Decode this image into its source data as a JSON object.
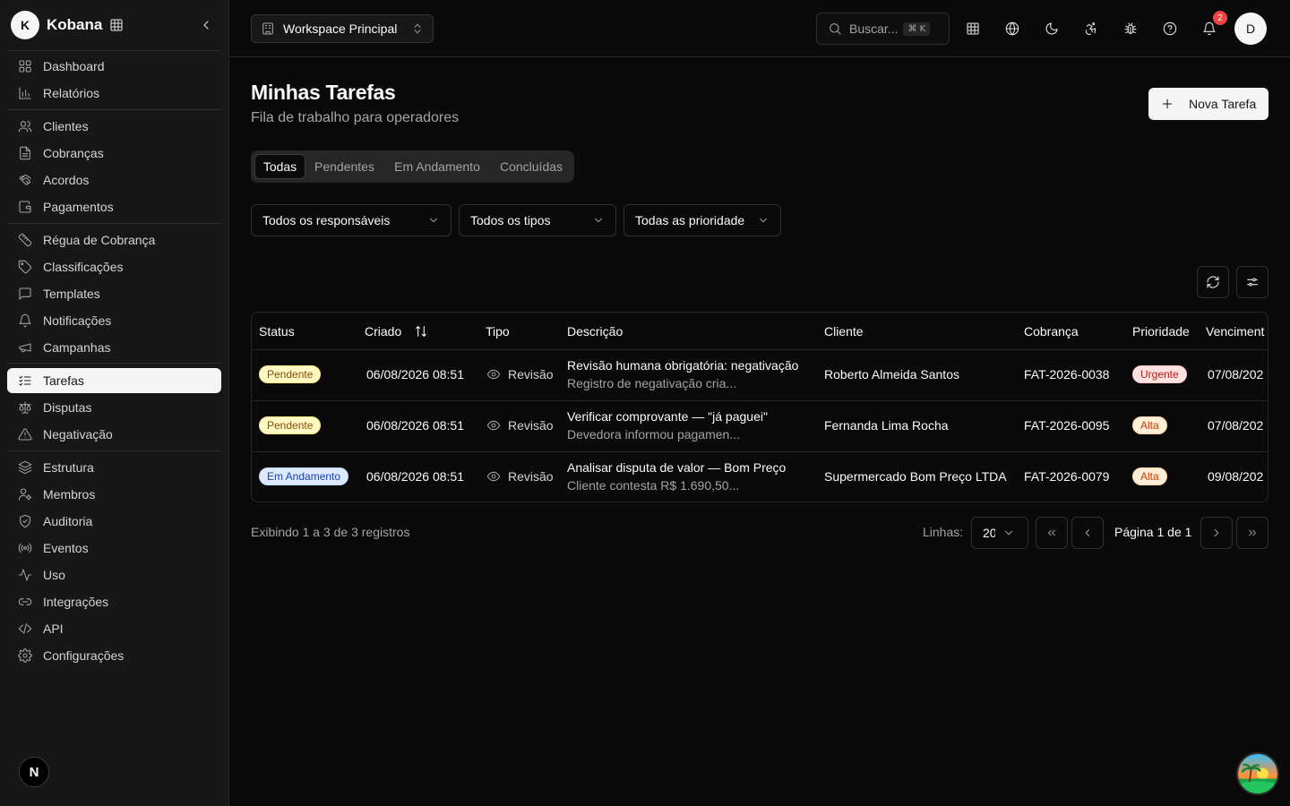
{
  "brand": {
    "avatar_letter": "K",
    "name": "Kobana"
  },
  "sidebar": {
    "groups": [
      [
        {
          "label": "Dashboard",
          "icon": "layout-grid-icon"
        },
        {
          "label": "Relatórios",
          "icon": "bar-chart-icon"
        }
      ],
      [
        {
          "label": "Clientes",
          "icon": "users-icon"
        },
        {
          "label": "Cobranças",
          "icon": "file-text-icon"
        },
        {
          "label": "Acordos",
          "icon": "handshake-icon"
        },
        {
          "label": "Pagamentos",
          "icon": "wallet-icon"
        }
      ],
      [
        {
          "label": "Régua de Cobrança",
          "icon": "ruler-icon"
        },
        {
          "label": "Classificações",
          "icon": "tag-icon"
        },
        {
          "label": "Templates",
          "icon": "message-square-icon"
        },
        {
          "label": "Notificações",
          "icon": "bell-icon"
        },
        {
          "label": "Campanhas",
          "icon": "megaphone-icon"
        }
      ],
      [
        {
          "label": "Tarefas",
          "icon": "list-checks-icon",
          "active": true
        },
        {
          "label": "Disputas",
          "icon": "scale-icon"
        },
        {
          "label": "Negativação",
          "icon": "alert-triangle-icon"
        }
      ],
      [
        {
          "label": "Estrutura",
          "icon": "layers-icon"
        },
        {
          "label": "Membros",
          "icon": "user-cog-icon"
        },
        {
          "label": "Auditoria",
          "icon": "shield-check-icon"
        },
        {
          "label": "Eventos",
          "icon": "radio-icon"
        },
        {
          "label": "Uso",
          "icon": "activity-icon"
        },
        {
          "label": "Integrações",
          "icon": "link-icon"
        },
        {
          "label": "API",
          "icon": "code-icon"
        },
        {
          "label": "Configurações",
          "icon": "settings-icon"
        }
      ]
    ],
    "footer_badge": "N"
  },
  "topbar": {
    "workspace": "Workspace Principal",
    "search_placeholder": "Buscar...",
    "search_shortcut": "⌘ K",
    "notification_count": "2",
    "user_initial": "D"
  },
  "page": {
    "title": "Minhas Tarefas",
    "subtitle": "Fila de trabalho para operadores",
    "new_button": "Nova Tarefa"
  },
  "tabs": [
    {
      "label": "Todas",
      "active": true
    },
    {
      "label": "Pendentes"
    },
    {
      "label": "Em Andamento"
    },
    {
      "label": "Concluídas"
    }
  ],
  "filters": {
    "responsible": "Todos os responsáveis",
    "type": "Todos os tipos",
    "priority": "Todas as prioridade"
  },
  "table": {
    "columns": [
      "Status",
      "Criado",
      "Tipo",
      "Descrição",
      "Cliente",
      "Cobrança",
      "Prioridade",
      "Venciment"
    ],
    "rows": [
      {
        "status": "Pendente",
        "status_kind": "pend",
        "created": "06/08/2026 08:51",
        "type": "Revisão",
        "desc_title": "Revisão humana obrigatória: negativação",
        "desc_sub": "Registro de negativação cria...",
        "client": "Roberto Almeida Santos",
        "charge": "FAT-2026-0038",
        "priority": "Urgente",
        "priority_kind": "urg",
        "due": "07/08/202"
      },
      {
        "status": "Pendente",
        "status_kind": "pend",
        "created": "06/08/2026 08:51",
        "type": "Revisão",
        "desc_title": "Verificar comprovante — \"já paguei\"",
        "desc_sub": "Devedora informou pagamen...",
        "client": "Fernanda Lima Rocha",
        "charge": "FAT-2026-0095",
        "priority": "Alta",
        "priority_kind": "alta",
        "due": "07/08/202"
      },
      {
        "status": "Em Andamento",
        "status_kind": "prog",
        "created": "06/08/2026 08:51",
        "type": "Revisão",
        "desc_title": "Analisar disputa de valor — Bom Preço",
        "desc_sub": "Cliente contesta R$ 1.690,50...",
        "client": "Supermercado Bom Preço LTDA",
        "charge": "FAT-2026-0079",
        "priority": "Alta",
        "priority_kind": "alta",
        "due": "09/08/202"
      }
    ]
  },
  "pagination": {
    "summary": "Exibindo 1 a 3 de 3 registros",
    "rows_label": "Linhas:",
    "rows_value": "20",
    "page_text": "Página 1 de 1"
  }
}
